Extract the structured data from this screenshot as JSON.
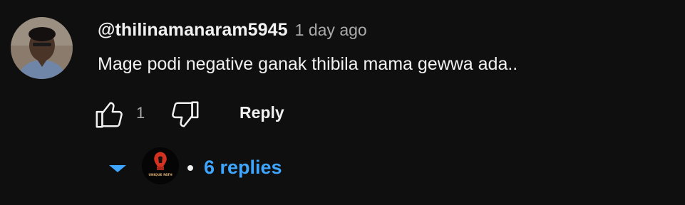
{
  "comment": {
    "author": "@thilinamanaram5945",
    "time": "1 day ago",
    "text": "Mage podi negative ganak thibila mama gewwa ada..",
    "like_count": "1",
    "reply_label": "Reply"
  },
  "replies": {
    "toggle_label": "6 replies",
    "reply_avatar_text": "UNIQUE PATH"
  },
  "colors": {
    "background": "#0f0f0f",
    "text": "#f1f1f1",
    "secondary_text": "#aaaaaa",
    "accent": "#3ea6ff"
  },
  "icons": {
    "like": "thumb-up-icon",
    "dislike": "thumb-down-icon",
    "expand": "caret-down-icon"
  }
}
